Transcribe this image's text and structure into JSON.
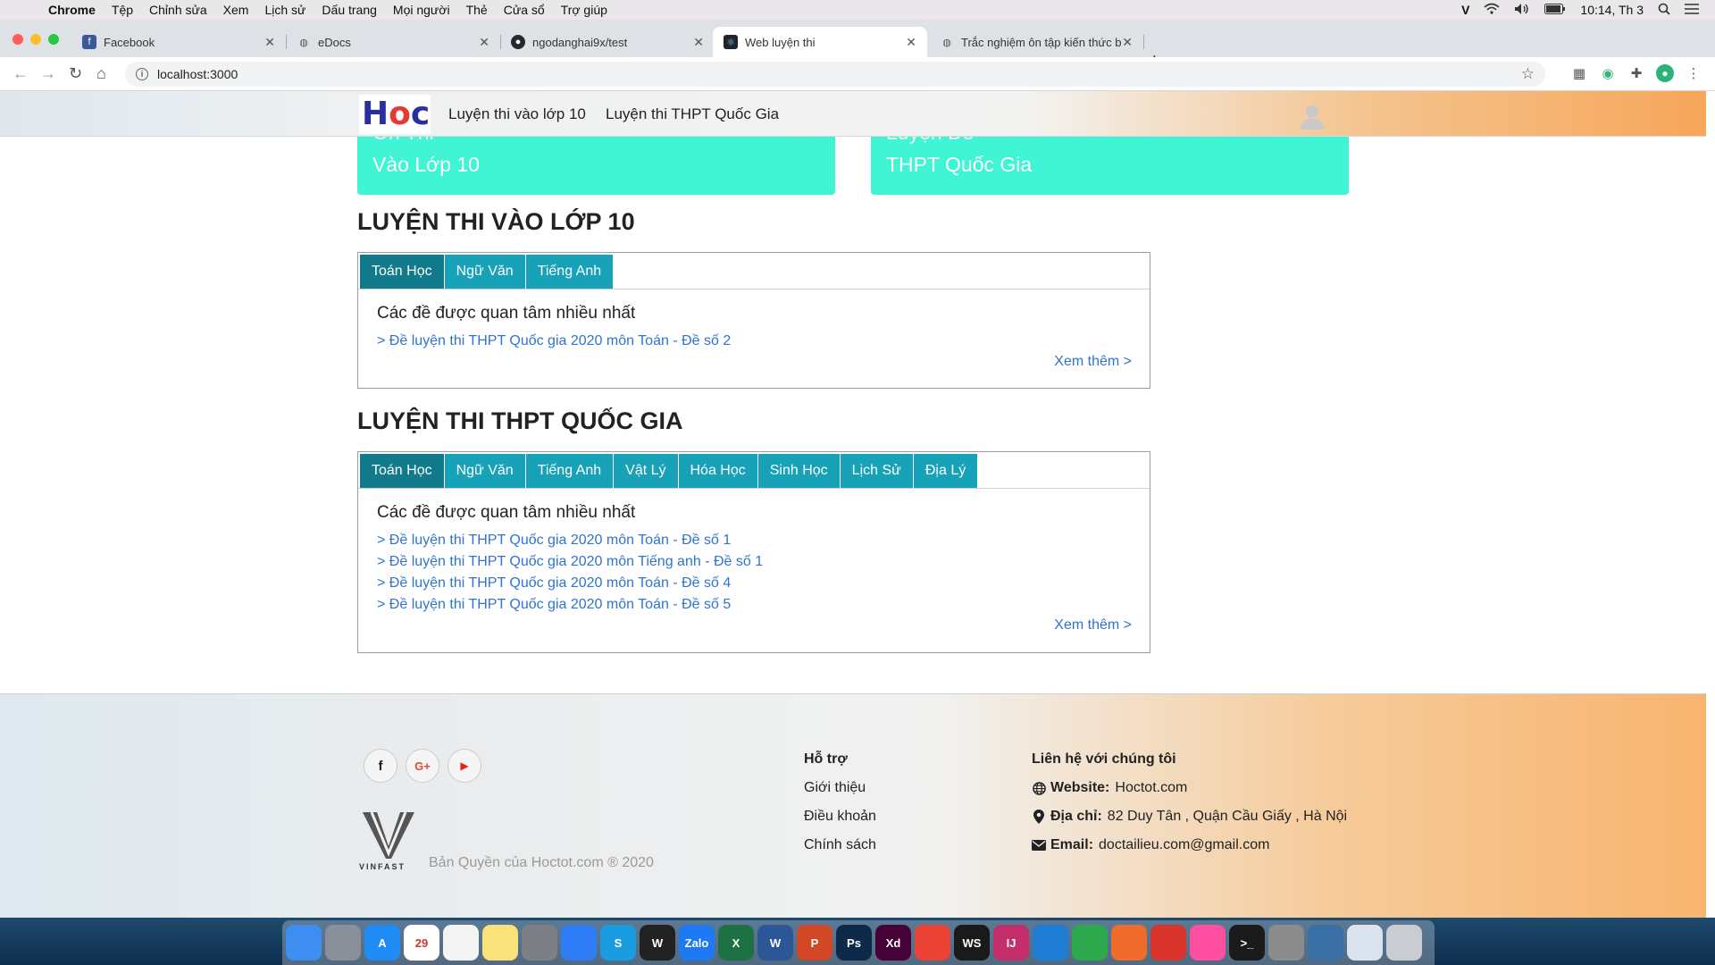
{
  "menubar": {
    "app": "Chrome",
    "items": [
      "Tệp",
      "Chỉnh sửa",
      "Xem",
      "Lịch sử",
      "Dấu trang",
      "Mọi người",
      "Thẻ",
      "Cửa sổ",
      "Trợ giúp"
    ],
    "clock": "10:14, Th 3"
  },
  "browser": {
    "tabs": [
      {
        "title": "Facebook",
        "icon": "facebook-icon"
      },
      {
        "title": "eDocs",
        "icon": "globe-icon"
      },
      {
        "title": "ngodanghai9x/test",
        "icon": "github-icon"
      },
      {
        "title": "Web luyện thi",
        "icon": "react-icon"
      },
      {
        "title": "Trắc nghiệm ôn tập kiến thức b",
        "icon": "globe-icon"
      }
    ],
    "url": "localhost:3000"
  },
  "site": {
    "logo": {
      "h": "H",
      "o": "o",
      "c": "c"
    },
    "nav": [
      "Luyện thi vào lớp 10",
      "Luyện thi THPT Quốc Gia"
    ],
    "hero": [
      {
        "line1": "Ôn Thi",
        "line2": "Vào Lớp 10"
      },
      {
        "line1": "Luyện Đề",
        "line2": "THPT Quốc Gia"
      }
    ]
  },
  "section10": {
    "title": "LUYỆN THI VÀO LỚP 10",
    "tabs": [
      "Toán Học",
      "Ngữ Văn",
      "Tiếng Anh"
    ],
    "heading": "Các đề được quan tâm nhiều nhất",
    "links": [
      "> Đề luyện thi THPT Quốc gia 2020 môn Toán - Đề số 2"
    ],
    "more": "Xem thêm >"
  },
  "sectionTHPT": {
    "title": "LUYỆN THI THPT QUỐC GIA",
    "tabs": [
      "Toán Học",
      "Ngữ Văn",
      "Tiếng Anh",
      "Vật Lý",
      "Hóa Học",
      "Sinh Học",
      "Lịch Sử",
      "Địa Lý"
    ],
    "heading": "Các đề được quan tâm nhiều nhất",
    "links": [
      "> Đề luyện thi THPT Quốc gia 2020 môn Toán - Đề số 1",
      "> Đề luyện thi THPT Quốc gia 2020 môn Tiếng anh - Đề số 1",
      "> Đề luyện thi THPT Quốc gia 2020 môn Toán - Đề số 4",
      "> Đề luyện thi THPT Quốc gia 2020 môn Toán - Đề số 5"
    ],
    "more": "Xem thêm >"
  },
  "footer": {
    "social": [
      "f",
      "G+",
      "▶"
    ],
    "brand": "VINFAST",
    "copyright": "Bản Quyền của Hoctot.com ® 2020",
    "support": {
      "title": "Hỗ trợ",
      "links": [
        "Giới thiệu",
        "Điều khoản",
        "Chính sách"
      ]
    },
    "contact": {
      "title": "Liên hệ với chúng tôi",
      "website_label": "Website:",
      "website": "Hoctot.com",
      "address_label": "Địa chỉ:",
      "address": "82 Duy Tân , Quận Cầu Giấy , Hà Nội",
      "email_label": "Email:",
      "email": "doctailieu.com@gmail.com"
    }
  },
  "dock": {
    "calendar_day": "29",
    "apps": [
      {
        "name": "finder-icon",
        "label": "",
        "color": "#3d8ef0"
      },
      {
        "name": "launchpad-icon",
        "label": "",
        "color": "#8a8f99"
      },
      {
        "name": "app-store-icon",
        "label": "A",
        "color": "#1f8cf5"
      },
      {
        "name": "calendar-icon",
        "label": "29",
        "color": "#ffffff"
      },
      {
        "name": "reminders-icon",
        "label": "",
        "color": "#f4f4f4"
      },
      {
        "name": "notes-icon",
        "label": "",
        "color": "#f8e27a"
      },
      {
        "name": "system-preferences-icon",
        "label": "",
        "color": "#7d7f85"
      },
      {
        "name": "messenger-icon",
        "label": "",
        "color": "#2f7df6"
      },
      {
        "name": "skype-icon",
        "label": "S",
        "color": "#1a9de0"
      },
      {
        "name": "wire-icon",
        "label": "W",
        "color": "#222"
      },
      {
        "name": "zalo-icon",
        "label": "Zalo",
        "color": "#1f79f2"
      },
      {
        "name": "excel-icon",
        "label": "X",
        "color": "#1e7145"
      },
      {
        "name": "word-icon",
        "label": "W",
        "color": "#2b5797"
      },
      {
        "name": "powerpoint-icon",
        "label": "P",
        "color": "#d24726"
      },
      {
        "name": "photoshop-icon",
        "label": "Ps",
        "color": "#0d2a4a"
      },
      {
        "name": "xd-icon",
        "label": "Xd",
        "color": "#470137"
      },
      {
        "name": "chrome-icon",
        "label": "",
        "color": "#ea4335"
      },
      {
        "name": "webstorm-icon",
        "label": "WS",
        "color": "#1a1a1a"
      },
      {
        "name": "intellij-icon",
        "label": "IJ",
        "color": "#c42e6b"
      },
      {
        "name": "vscode-icon",
        "label": "",
        "color": "#1f7ed4"
      },
      {
        "name": "affinity-icon",
        "label": "",
        "color": "#2ea84d"
      },
      {
        "name": "postman-icon",
        "label": "",
        "color": "#ef6c2c"
      },
      {
        "name": "vpn-icon",
        "label": "",
        "color": "#d9342b"
      },
      {
        "name": "eraser-icon",
        "label": "",
        "color": "#ff4fa0"
      },
      {
        "name": "terminal-icon",
        "label": ">_",
        "color": "#1b1b1b"
      },
      {
        "name": "keychain-icon",
        "label": "",
        "color": "#8c8c8c"
      },
      {
        "name": "mysql-workbench-icon",
        "label": "",
        "color": "#3a6fa5"
      },
      {
        "name": "documents-icon",
        "label": "",
        "color": "#dbe4ee"
      },
      {
        "name": "trash-icon",
        "label": "",
        "color": "#c9ccd1"
      }
    ]
  }
}
